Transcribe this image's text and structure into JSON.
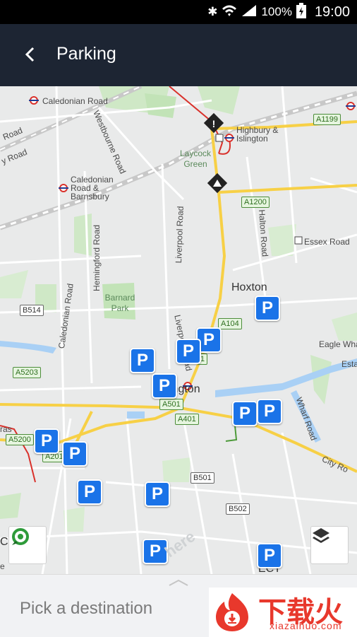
{
  "status_bar": {
    "battery": "100%",
    "time": "19:00"
  },
  "app_bar": {
    "title": "Parking"
  },
  "map": {
    "roads": {
      "caledonian_road_1": "Caledonian Road",
      "westbourne_road": "Westbourne Road",
      "caledonian_barnsbury": "Caledonian Road & Barnsbury",
      "highbury": "Highbury & Islington",
      "laycock_green": "Laycock Green",
      "hemingford": "Hemingford Road",
      "liverpool_road_1": "Liverpool Road",
      "liverpool_road_2": "Liverpool Road",
      "halton_road": "Halton Road",
      "essex_road": "Essex Road",
      "caledonian_road_2": "Caledonian Road",
      "barnard_park": "Barnard Park",
      "hoxton": "Hoxton",
      "islington": "Islington",
      "eagle_wharf": "Eagle Wha",
      "estate": "Esta",
      "wharf_road": "Wharf Road",
      "city_road": "City Ro",
      "left_road_1": "Road",
      "left_road_2": "y Road",
      "ras": "ras",
      "left_c": "C",
      "left_e": "e",
      "ect": "ECT"
    },
    "shields": {
      "a1199": "A1199",
      "a1200": "A1200",
      "b514": "B514",
      "a104": "A104",
      "a5203": "A5203",
      "a501": "A501",
      "a401": "A401",
      "a5200": "A5200",
      "a201": "A201",
      "b501": "B501",
      "b502": "B502",
      "a1_partial": "1"
    },
    "parking_label": "P",
    "watermark_brand": "here"
  },
  "controls": {
    "location_icon": "location-marker-icon",
    "layers_icon": "layers-icon"
  },
  "bottom_sheet": {
    "placeholder": "Pick a destination"
  },
  "watermark": {
    "chinese": "下载火",
    "url": "xiazaihuo.com"
  },
  "colors": {
    "appbar": "#1d2533",
    "parking": "#1a73e8",
    "major_road": "#f7d046",
    "underground": "#d9312b"
  }
}
